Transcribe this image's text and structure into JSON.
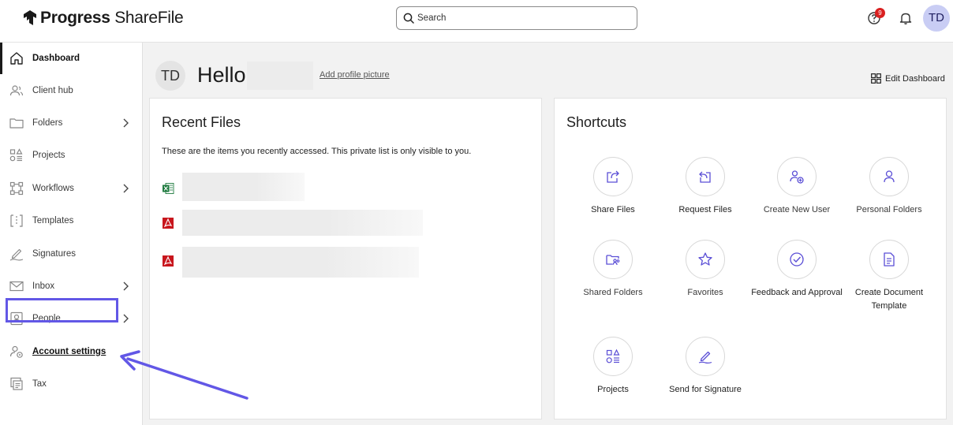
{
  "header": {
    "logo_prefix": "Progress",
    "logo_suffix": "ShareFile",
    "search_placeholder": "Search",
    "help_badge_count": "9",
    "user_initials": "TD"
  },
  "sidebar": {
    "items": [
      {
        "label": "Dashboard"
      },
      {
        "label": "Client hub"
      },
      {
        "label": "Folders"
      },
      {
        "label": "Projects"
      },
      {
        "label": "Workflows"
      },
      {
        "label": "Templates"
      },
      {
        "label": "Signatures"
      },
      {
        "label": "Inbox"
      },
      {
        "label": "People"
      },
      {
        "label": "Account settings"
      },
      {
        "label": "Tax"
      }
    ]
  },
  "main": {
    "avatar_initials": "TD",
    "greeting": "Hello",
    "add_profile_picture": "Add profile picture",
    "edit_dashboard": "Edit Dashboard"
  },
  "recent_files": {
    "title": "Recent Files",
    "description": "These are the items you recently accessed. This private list is only visible to you.",
    "files": [
      {
        "type": "excel-icon"
      },
      {
        "type": "pdf-icon"
      },
      {
        "type": "pdf-icon"
      }
    ]
  },
  "shortcuts": {
    "title": "Shortcuts",
    "items": [
      {
        "label": "Share Files",
        "icon": "share-files-icon"
      },
      {
        "label": "Request Files",
        "icon": "request-files-icon"
      },
      {
        "label": "Create New User",
        "icon": "create-user-icon"
      },
      {
        "label": "Personal Folders",
        "icon": "personal-folders-icon"
      },
      {
        "label": "Shared Folders",
        "icon": "shared-folders-icon"
      },
      {
        "label": "Favorites",
        "icon": "star-icon"
      },
      {
        "label": "Feedback and Approval",
        "icon": "check-circle-icon"
      },
      {
        "label": "Create Document Template",
        "icon": "document-icon"
      },
      {
        "label": "Projects",
        "icon": "projects-icon"
      },
      {
        "label": "Send for Signature",
        "icon": "pen-icon"
      }
    ]
  },
  "colors": {
    "accent": "#6257e6",
    "shortcut_icon": "#5b4fd6",
    "badge": "#d92020",
    "excel": "#1d7a3e",
    "pdf": "#c8161d"
  }
}
